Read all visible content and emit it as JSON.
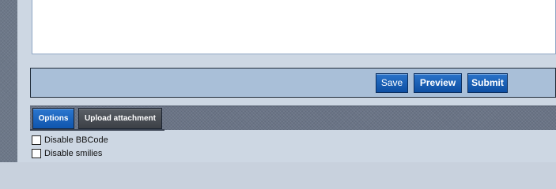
{
  "editor": {
    "message_value": ""
  },
  "actions": {
    "save_label": "Save",
    "preview_label": "Preview",
    "submit_label": "Submit"
  },
  "tabs": [
    {
      "label": "Options",
      "active": true
    },
    {
      "label": "Upload attachment",
      "active": false
    }
  ],
  "options": [
    {
      "label": "Disable BBCode",
      "checked": false
    },
    {
      "label": "Disable smilies",
      "checked": false
    }
  ],
  "colors": {
    "button_blue": "#1663be",
    "panel_bg": "#cdd7e3",
    "submit_bar_bg": "#a9bfd8",
    "tab_bar_bg": "#6a7486",
    "inactive_tab": "#4a4e55"
  }
}
